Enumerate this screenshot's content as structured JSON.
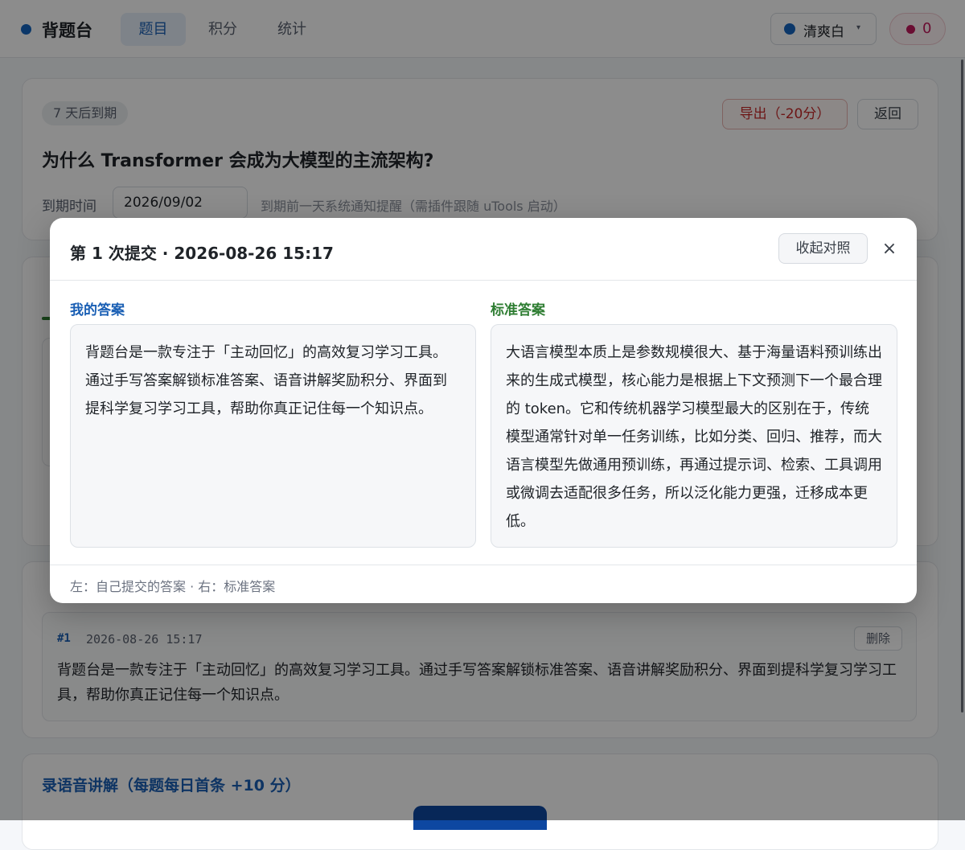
{
  "header": {
    "brand": "背题台",
    "tabs": [
      {
        "label": "题目",
        "active": true
      },
      {
        "label": "积分",
        "active": false
      },
      {
        "label": "统计",
        "active": false
      }
    ],
    "theme": "清爽白",
    "score": "0"
  },
  "question": {
    "due_badge": "7 天后到期",
    "export_label": "导出（-20分）",
    "back_label": "返回",
    "title": "为什么 Transformer 会成为大模型的主流架构?",
    "due_label": "到期时间",
    "due_date": "2026/09/02",
    "due_hint": "到期前一天系统通知提醒（需插件跟随 uTools 启动）"
  },
  "history": {
    "item": {
      "index": "#1",
      "time": "2026-08-26 15:17",
      "delete_label": "删除",
      "text": "背题台是一款专注于「主动回忆」的高效复习学习工具。通过手写答案解锁标准答案、语音讲解奖励积分、界面到提科学复习学习工具，帮助你真正记住每一个知识点。"
    }
  },
  "voice": {
    "title": "录语音讲解（每题每日首条 +10 分）"
  },
  "modal": {
    "title": "第 1 次提交 · 2026-08-26 15:17",
    "collapse_label": "收起对照",
    "close_symbol": "×",
    "mine_label": "我的答案",
    "std_label": "标准答案",
    "mine_answer": "背题台是一款专注于「主动回忆」的高效复习学习工具。通过手写答案解锁标准答案、语音讲解奖励积分、界面到提科学复习学习工具，帮助你真正记住每一个知识点。",
    "std_answer": "大语言模型本质上是参数规模很大、基于海量语料预训练出来的生成式模型，核心能力是根据上下文预测下一个最合理的 token。它和传统机器学习模型最大的区别在于，传统模型通常针对单一任务训练，比如分类、回归、推荐，而大语言模型先做通用预训练，再通过提示词、检索、工具调用或微调去适配很多任务，所以泛化能力更强，迁移成本更低。",
    "footer": "左：自己提交的答案 · 右：标准答案"
  },
  "colors": {
    "accent": "#1a5fb4",
    "standard": "#2e7d32",
    "danger": "#c62828",
    "score": "#c2185b"
  }
}
